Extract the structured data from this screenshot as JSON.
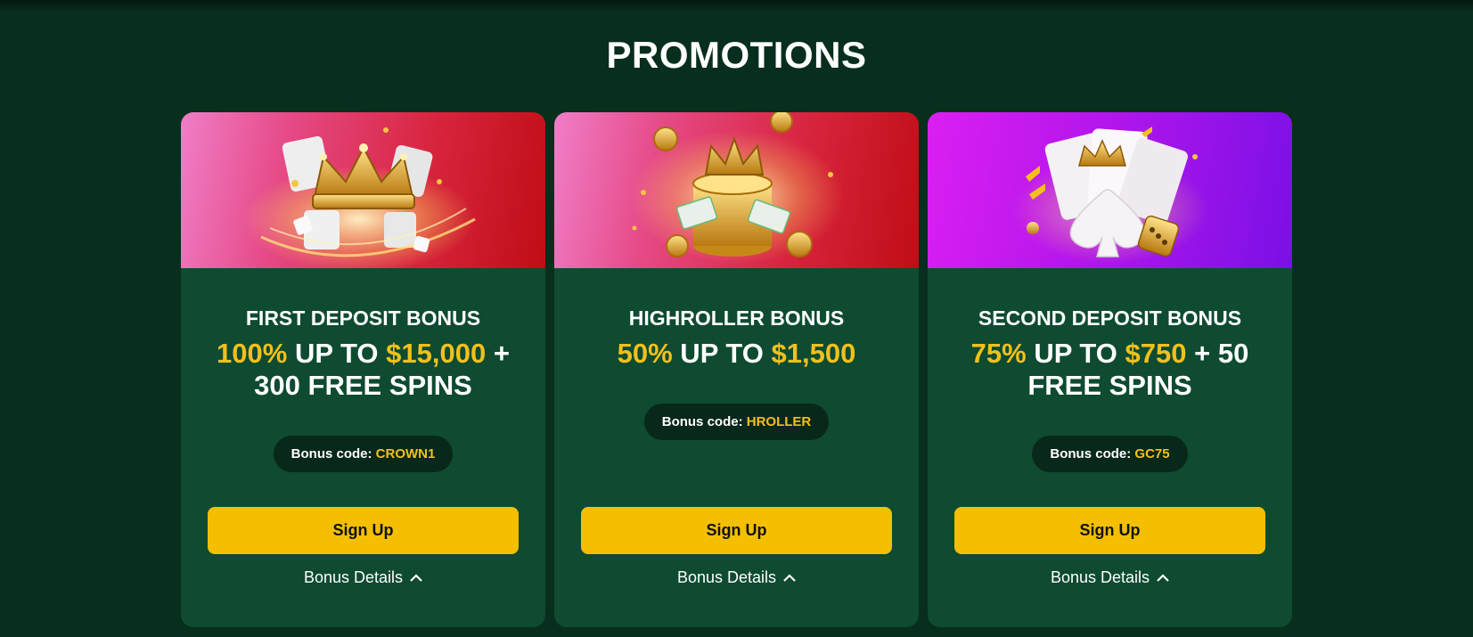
{
  "page": {
    "title": "PROMOTIONS"
  },
  "colors": {
    "background": "#082e1d",
    "card": "#0e4b31",
    "accent": "#f2c01c",
    "button": "#f3bf00",
    "pill": "#082819"
  },
  "promotions": [
    {
      "title": "FIRST DEPOSIT BONUS",
      "offer": {
        "p1": "100%",
        "p2": " UP TO ",
        "p3": "$15,000",
        "p4": " + 300 FREE SPINS"
      },
      "code_label": "Bonus code: ",
      "code": "CROWN1",
      "button": "Sign Up",
      "details": "Bonus Details",
      "banner": "crown-gifts-dice-illustration"
    },
    {
      "title": "HIGHROLLER BONUS",
      "offer": {
        "p1": "50%",
        "p2": " UP TO ",
        "p3": "$1,500",
        "p4": ""
      },
      "code_label": "Bonus code: ",
      "code": "HROLLER",
      "button": "Sign Up",
      "details": "Bonus Details",
      "banner": "crown-coins-cash-illustration"
    },
    {
      "title": "SECOND DEPOSIT BONUS",
      "offer": {
        "p1": "75%",
        "p2": " UP TO ",
        "p3": "$750",
        "p4": " + 50 FREE SPINS"
      },
      "code_label": "Bonus code: ",
      "code": "GC75",
      "button": "Sign Up",
      "details": "Bonus Details",
      "banner": "cards-spade-dice-illustration"
    }
  ]
}
